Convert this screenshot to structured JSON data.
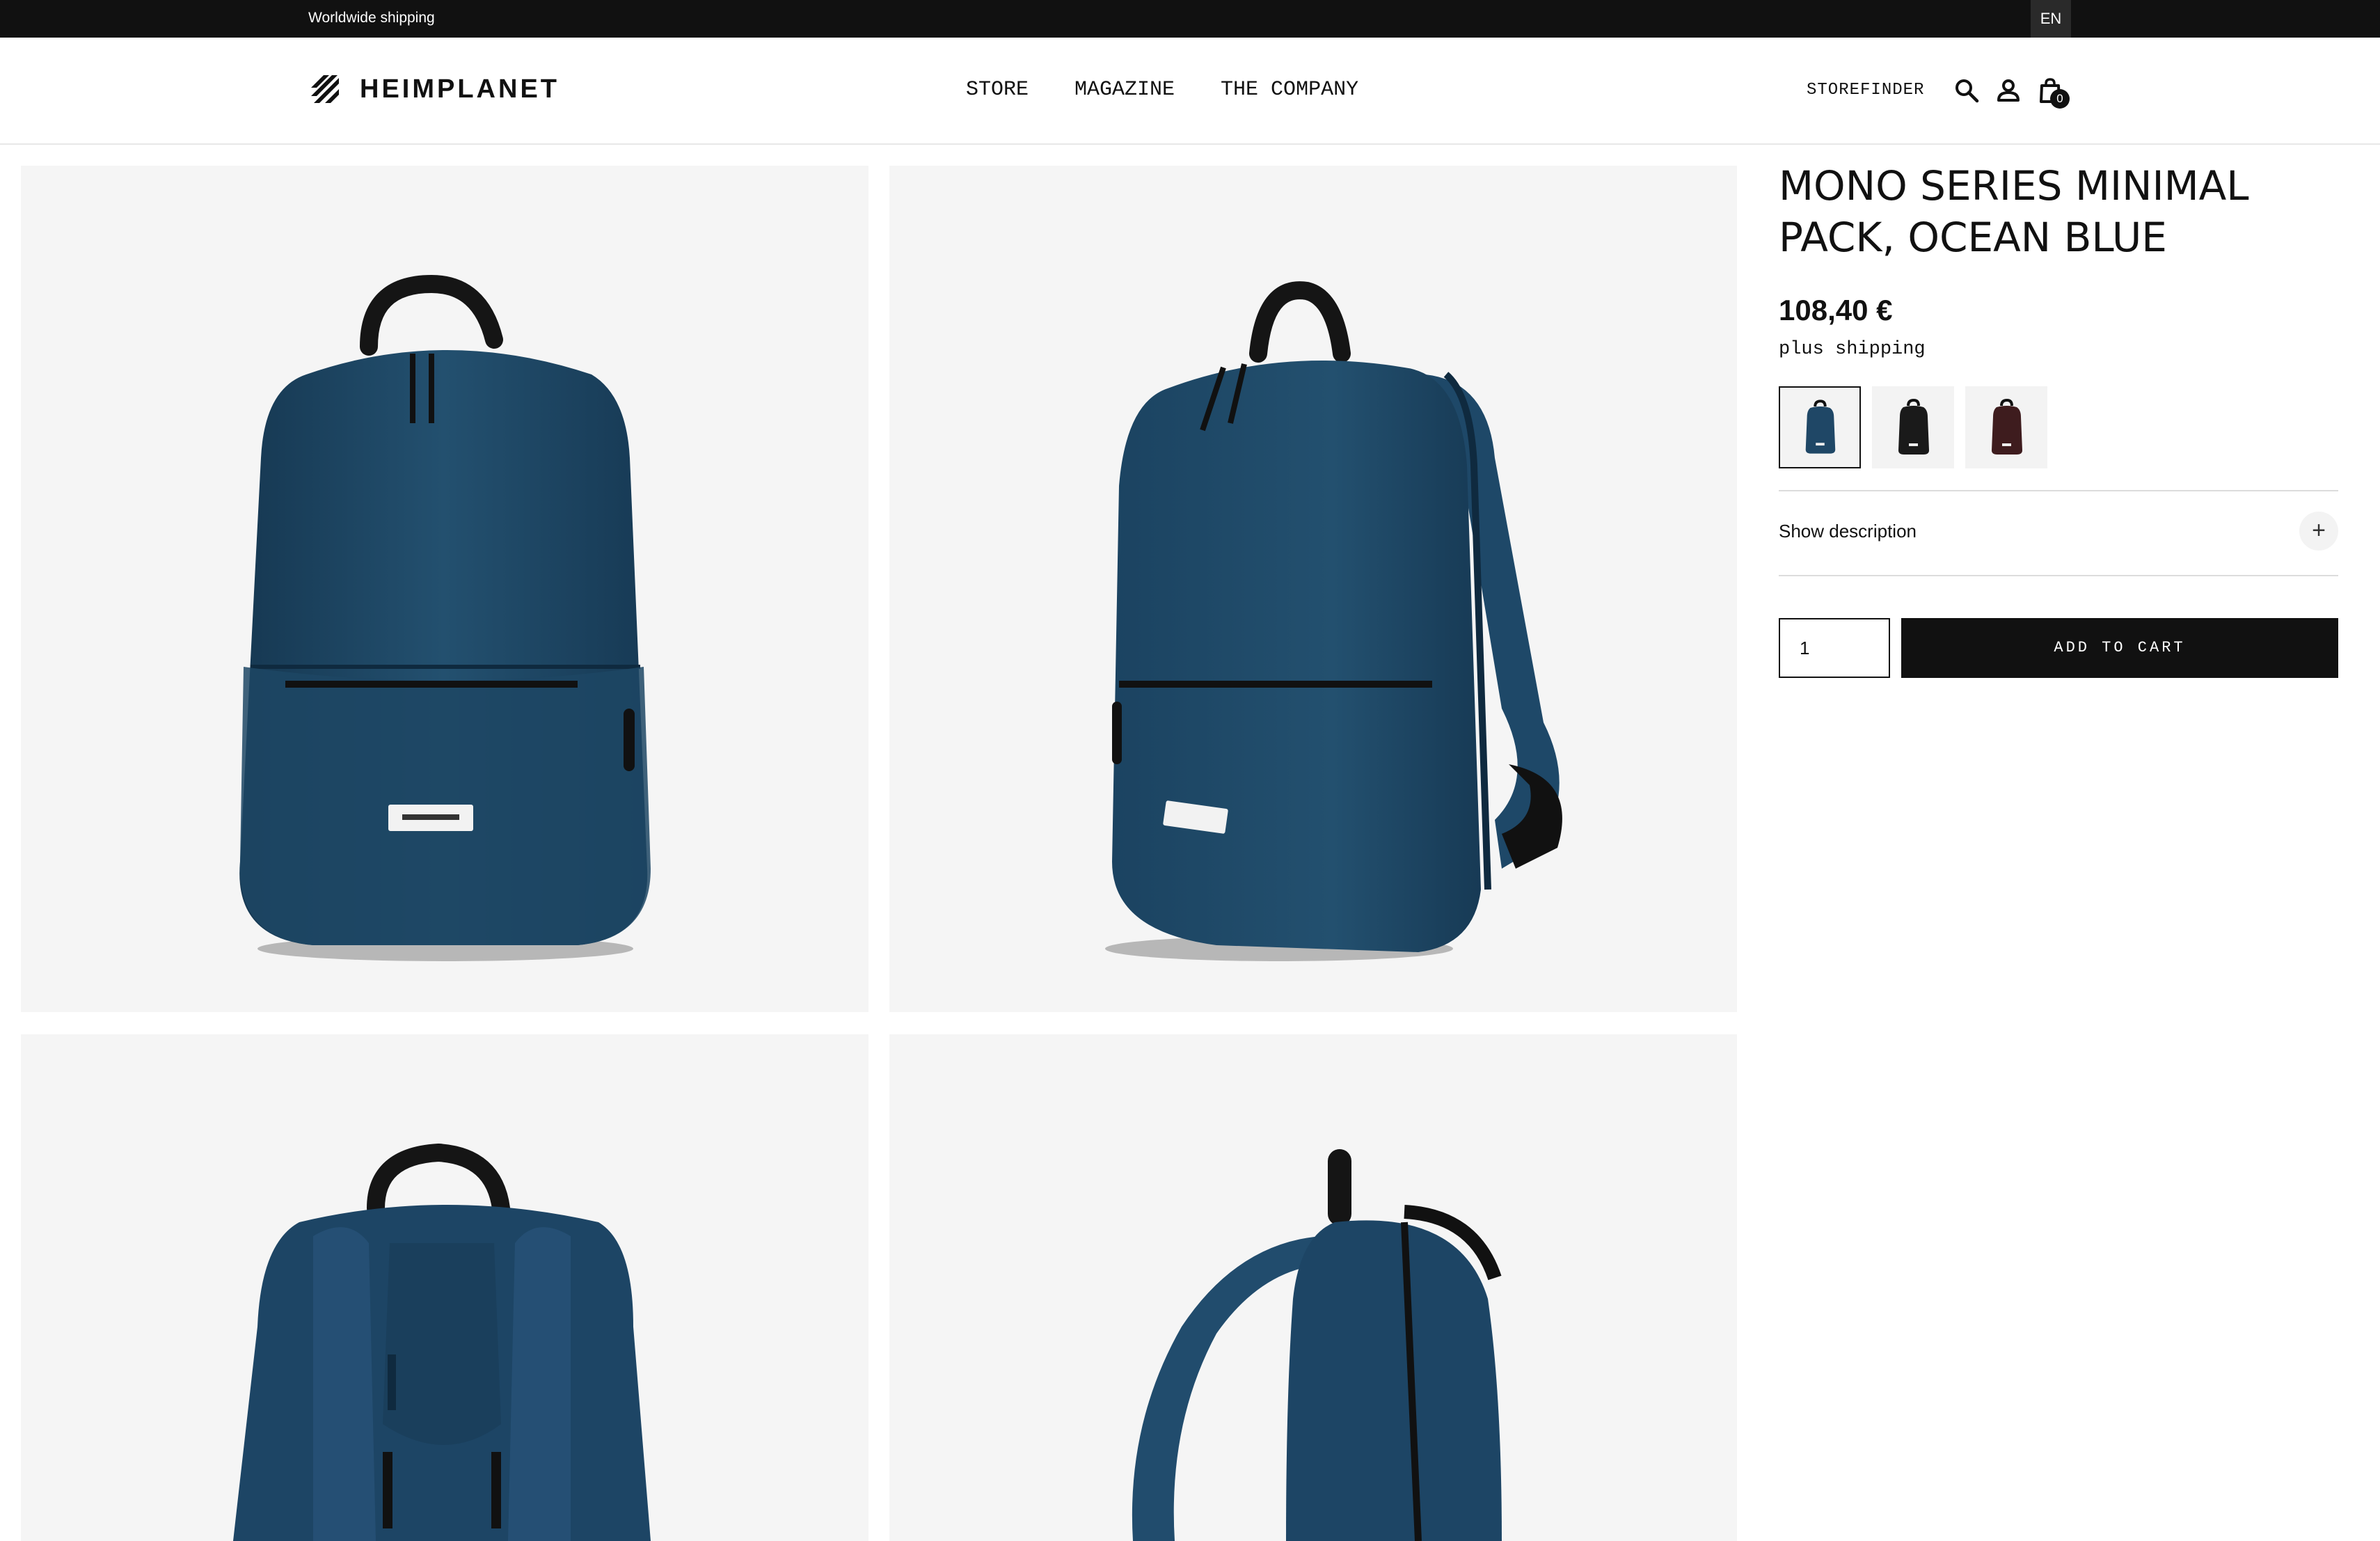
{
  "topbar": {
    "shipping_text": "Worldwide shipping",
    "language": "EN"
  },
  "header": {
    "brand": "HEIMPLANET",
    "nav": [
      {
        "label": "STORE"
      },
      {
        "label": "MAGAZINE"
      },
      {
        "label": "THE COMPANY"
      }
    ],
    "storefinder": "STOREFINDER",
    "cart_count": "0",
    "icons": [
      "search-icon",
      "account-icon",
      "shopping-bag-icon"
    ]
  },
  "gallery": {
    "images": [
      {
        "name": "front-view",
        "icon": "backpack-front-image"
      },
      {
        "name": "angled-view",
        "icon": "backpack-angled-image"
      },
      {
        "name": "back-view",
        "icon": "backpack-back-image"
      },
      {
        "name": "side-view",
        "icon": "backpack-side-image"
      }
    ],
    "bag_color": "#1f4766",
    "tile_background": "#f5f5f5"
  },
  "product": {
    "title": "MONO SERIES MINIMAL PACK, OCEAN BLUE",
    "price": "108,40 €",
    "shipping_note": "plus shipping",
    "variants": [
      {
        "name": "ocean-blue",
        "color": "#1f4766",
        "selected": true
      },
      {
        "name": "black",
        "color": "#1a1a1a",
        "selected": false
      },
      {
        "name": "burgundy",
        "color": "#3e1c1e",
        "selected": false
      }
    ],
    "description_toggle": "Show description",
    "quantity": "1",
    "add_to_cart": "ADD TO CART"
  }
}
